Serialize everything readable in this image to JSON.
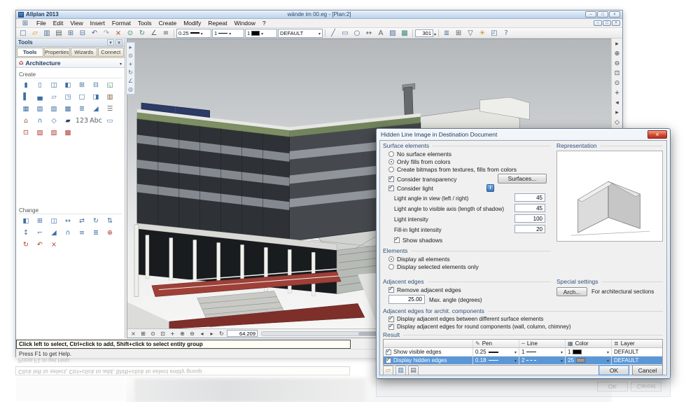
{
  "app": {
    "title": "Allplan 2013",
    "doc_title": "wände im 00.eg - [Plan:2]"
  },
  "window_controls": [
    {
      "name": "minimize-button",
      "glyph": "–"
    },
    {
      "name": "restore-button",
      "glyph": "□"
    },
    {
      "name": "close-button",
      "glyph": "×"
    }
  ],
  "menu": {
    "items": [
      "File",
      "Edit",
      "View",
      "Insert",
      "Format",
      "Tools",
      "Create",
      "Modify",
      "Repeat",
      "Window",
      "?"
    ]
  },
  "toolbar": {
    "left_icons": [
      {
        "name": "new-file-icon",
        "glyph": "□",
        "c": "#4a6e9e"
      },
      {
        "name": "open-file-icon",
        "glyph": "▱",
        "c": "#c9952c"
      },
      {
        "name": "save-icon",
        "glyph": "▥",
        "c": "#4a6e9e"
      },
      {
        "name": "print-icon",
        "glyph": "▤",
        "c": "#5a5f66"
      },
      {
        "name": "copy-icon",
        "glyph": "⊞",
        "c": "#4a6e9e"
      },
      {
        "name": "paste-icon",
        "glyph": "⊟",
        "c": "#4a6e9e"
      },
      {
        "name": "undo-icon",
        "glyph": "↶",
        "c": "#4a6e9e"
      },
      {
        "name": "redo-icon",
        "glyph": "↷",
        "c": "#9aa2ad"
      },
      {
        "name": "delete-icon",
        "glyph": "×",
        "c": "#b03a30"
      },
      {
        "name": "zoom-all-icon",
        "glyph": "⊙",
        "c": "#3e8a7a"
      },
      {
        "name": "refresh-icon",
        "glyph": "↻",
        "c": "#3e8a7a"
      },
      {
        "name": "measure-icon",
        "glyph": "∠",
        "c": "#5a5f66"
      },
      {
        "name": "options-icon",
        "glyph": "≡",
        "c": "#5a5f66"
      }
    ],
    "pen": {
      "value": "0.25"
    },
    "linetype": {
      "value": "1"
    },
    "linecolor": {
      "value": "1"
    },
    "layer": {
      "value": "DEFAULT"
    },
    "mid_icons": [
      {
        "name": "line-tool-icon",
        "glyph": "╱",
        "c": "#4a6e9e"
      },
      {
        "name": "rectangle-tool-icon",
        "glyph": "▭",
        "c": "#4a6e9e"
      },
      {
        "name": "circle-tool-icon",
        "glyph": "○",
        "c": "#4a6e9e"
      },
      {
        "name": "dimension-tool-icon",
        "glyph": "↔",
        "c": "#5a5f66"
      },
      {
        "name": "text-tool-icon",
        "glyph": "A",
        "c": "#5a5f66"
      },
      {
        "name": "hatch-tool-icon",
        "glyph": "▨",
        "c": "#4a6e9e"
      },
      {
        "name": "fill-tool-icon",
        "glyph": "▩",
        "c": "#3e8a7a"
      }
    ],
    "scale": {
      "value": "301"
    },
    "right_icons": [
      {
        "name": "layer-manager-icon",
        "glyph": "≣",
        "c": "#4a6e9e"
      },
      {
        "name": "group-icon",
        "glyph": "⊞",
        "c": "#5a5f66"
      },
      {
        "name": "filter-icon",
        "glyph": "▽",
        "c": "#5a5f66"
      },
      {
        "name": "light-icon",
        "glyph": "☀",
        "c": "#c9952c"
      },
      {
        "name": "views-icon",
        "glyph": "◰",
        "c": "#4a6e9e"
      },
      {
        "name": "help-icon",
        "glyph": "?",
        "c": "#4a6e9e"
      }
    ]
  },
  "palette": {
    "header": "Tools",
    "header_icons": [
      {
        "name": "pin-icon",
        "glyph": "▾"
      },
      {
        "name": "close-icon",
        "glyph": "×"
      }
    ],
    "tabs": [
      "Tools",
      "Properties",
      "Wizards",
      "Connect"
    ],
    "active_tab": "Tools",
    "category": "Architecture",
    "create_label": "Create",
    "change_label": "Change",
    "create_icons": [
      {
        "name": "wall-tool",
        "glyph": "▮",
        "c": "#3e6ea5"
      },
      {
        "name": "profile-wall-tool",
        "glyph": "▯",
        "c": "#3e6ea5"
      },
      {
        "name": "double-wall-tool",
        "glyph": "◫",
        "c": "#3e6ea5"
      },
      {
        "name": "door-tool",
        "glyph": "◧",
        "c": "#3e6ea5"
      },
      {
        "name": "window-tool",
        "glyph": "⊞",
        "c": "#3e6ea5"
      },
      {
        "name": "french-window-tool",
        "glyph": "⊟",
        "c": "#3e6ea5"
      },
      {
        "name": "smart-opening-tool",
        "glyph": "◱",
        "c": "#3e8a7a"
      },
      {
        "name": "column-tool",
        "glyph": "▌",
        "c": "#3e6ea5"
      },
      {
        "name": "beam-tool",
        "glyph": "▄",
        "c": "#3e6ea5"
      },
      {
        "name": "slab-tool",
        "glyph": "▱",
        "c": "#3e6ea5"
      },
      {
        "name": "recess-tool",
        "glyph": "◳",
        "c": "#3e6ea5"
      },
      {
        "name": "opening-tool",
        "glyph": "□",
        "c": "#3e6ea5"
      },
      {
        "name": "niche-tool",
        "glyph": "◨",
        "c": "#3e6ea5"
      },
      {
        "name": "chimney-tool",
        "glyph": "▥",
        "c": "#8a5a3a"
      },
      {
        "name": "grid-tool",
        "glyph": "▦",
        "c": "#3e6ea5"
      },
      {
        "name": "mesh-tool",
        "glyph": "▧",
        "c": "#3e6ea5"
      },
      {
        "name": "raster-tool",
        "glyph": "▨",
        "c": "#3e6ea5"
      },
      {
        "name": "ceiling-grid-tool",
        "glyph": "▩",
        "c": "#3e6ea5"
      },
      {
        "name": "stair-tool",
        "glyph": "≣",
        "c": "#3e6ea5"
      },
      {
        "name": "ramp-tool",
        "glyph": "◢",
        "c": "#3e6ea5"
      },
      {
        "name": "railing-tool",
        "glyph": "☰",
        "c": "#5a5f66"
      },
      {
        "name": "roof-tool",
        "glyph": "⌂",
        "c": "#8a5a3a"
      },
      {
        "name": "dormer-tool",
        "glyph": "∩",
        "c": "#3e6ea5"
      },
      {
        "name": "skylight-tool",
        "glyph": "◇",
        "c": "#3e6ea5"
      },
      {
        "name": "solar-panel-tool",
        "glyph": "▰",
        "c": "#2f3f6e"
      },
      {
        "name": "number-tool",
        "glyph": "123",
        "c": "#5a5f66"
      },
      {
        "name": "text-tool",
        "glyph": "Abc",
        "c": "#5a5f66"
      },
      {
        "name": "label-tool",
        "glyph": "▭",
        "c": "#3e6ea5"
      },
      {
        "name": "room-tool",
        "glyph": "⊡",
        "c": "#b03a30"
      },
      {
        "name": "surface-tool",
        "glyph": "▨",
        "c": "#b03a30"
      },
      {
        "name": "hatching-tool",
        "glyph": "▧",
        "c": "#b03a30"
      },
      {
        "name": "fill-tool",
        "glyph": "▩",
        "c": "#b03a30"
      }
    ],
    "change_icons": [
      {
        "name": "modify-wall-tool",
        "glyph": "◧",
        "c": "#3e6ea5"
      },
      {
        "name": "join-walls-tool",
        "glyph": "⊞",
        "c": "#3e6ea5"
      },
      {
        "name": "split-wall-tool",
        "glyph": "◫",
        "c": "#3e6ea5"
      },
      {
        "name": "stretch-tool",
        "glyph": "↔",
        "c": "#3e6ea5"
      },
      {
        "name": "mirror-tool",
        "glyph": "⇄",
        "c": "#3e6ea5"
      },
      {
        "name": "rotate-tool",
        "glyph": "↻",
        "c": "#3e6ea5"
      },
      {
        "name": "move-tool",
        "glyph": "⇅",
        "c": "#3e6ea5"
      },
      {
        "name": "modify-height-tool",
        "glyph": "↕",
        "c": "#3e6ea5"
      },
      {
        "name": "trim-tool",
        "glyph": "⌐",
        "c": "#3e6ea5"
      },
      {
        "name": "chamfer-tool",
        "glyph": "◢",
        "c": "#3e6ea5"
      },
      {
        "name": "fillet-tool",
        "glyph": "∩",
        "c": "#3e6ea5"
      },
      {
        "name": "offset-tool",
        "glyph": "≡",
        "c": "#3e6ea5"
      },
      {
        "name": "align-tool",
        "glyph": "≣",
        "c": "#3e6ea5"
      },
      {
        "name": "convert-tool",
        "glyph": "⊕",
        "c": "#b03a30"
      },
      {
        "name": "update-tool",
        "glyph": "↻",
        "c": "#b03a30"
      },
      {
        "name": "restore-tool",
        "glyph": "↶",
        "c": "#b03a30"
      },
      {
        "name": "delete-part-tool",
        "glyph": "×",
        "c": "#b03a30"
      }
    ],
    "strip_icons": [
      {
        "name": "select-icon",
        "glyph": "▸"
      },
      {
        "name": "zoom-icon",
        "glyph": "⊙"
      },
      {
        "name": "pan-icon",
        "glyph": "+"
      },
      {
        "name": "rotate-icon",
        "glyph": "↻"
      },
      {
        "name": "measure-icon",
        "glyph": "∠"
      },
      {
        "name": "camera-icon",
        "glyph": "◎"
      }
    ]
  },
  "viewport": {
    "coord": "64.209",
    "nav_icons": [
      {
        "name": "close-view-icon",
        "glyph": "×"
      },
      {
        "name": "grid-icon",
        "glyph": "⊞"
      },
      {
        "name": "zoom-fit-icon",
        "glyph": "⊙"
      },
      {
        "name": "zoom-section-icon",
        "glyph": "⊡"
      },
      {
        "name": "pan-icon",
        "glyph": "+"
      },
      {
        "name": "zoom-in-icon",
        "glyph": "⊕"
      },
      {
        "name": "zoom-out-icon",
        "glyph": "⊖"
      },
      {
        "name": "view-prev-icon",
        "glyph": "◂"
      },
      {
        "name": "view-next-icon",
        "glyph": "▸"
      },
      {
        "name": "redraw-icon",
        "glyph": "↻"
      }
    ]
  },
  "right_toolbar": {
    "icons": [
      {
        "name": "pointer-icon",
        "glyph": "▸",
        "c": "#3c4148"
      },
      {
        "name": "zoom-in-icon",
        "glyph": "⊕",
        "c": "#3c4148"
      },
      {
        "name": "zoom-out-icon",
        "glyph": "⊖",
        "c": "#3c4148"
      },
      {
        "name": "zoom-window-icon",
        "glyph": "⊡",
        "c": "#3c4148"
      },
      {
        "name": "zoom-all-icon",
        "glyph": "⊙",
        "c": "#3c4148"
      },
      {
        "name": "pan-icon",
        "glyph": "+",
        "c": "#3c4148"
      },
      {
        "name": "view-prev-icon",
        "glyph": "◂",
        "c": "#3c4148"
      },
      {
        "name": "view-next-icon",
        "glyph": "▸",
        "c": "#3c4148"
      },
      {
        "name": "view-3d-icon",
        "glyph": "◇",
        "c": "#3c4148"
      },
      {
        "name": "redline-pen-icon",
        "glyph": "✎",
        "c": "#c0392b"
      },
      {
        "name": "eraser-icon",
        "glyph": "▭",
        "c": "#3c4148"
      }
    ]
  },
  "statusbar": {
    "prompt": "Click left to select, Ctrl+click to add, Shift+click to select entity group",
    "help": "Press F1 to get Help.",
    "right_icons": [
      {
        "name": "grid-status-icon",
        "glyph": "⊞"
      },
      {
        "name": "model-status-icon",
        "glyph": "⌂"
      }
    ]
  },
  "dialog": {
    "title": "Hidden Line Image in Destination Document",
    "surface": {
      "label": "Surface elements",
      "radios": [
        "No surface elements",
        "Only fills from colors",
        "Create bitmaps from textures, fills from colors"
      ],
      "selected": "Only fills from colors",
      "transparency": "Consider transparency",
      "surfaces_btn": "Surfaces...",
      "light": "Consider light",
      "rows": [
        {
          "label": "Light angle in view (left / right)",
          "value": "45"
        },
        {
          "label": "Light angle to visible axis (length of shadow)",
          "value": "45"
        },
        {
          "label": "Light intensity",
          "value": "100"
        },
        {
          "label": "Fill-in light intensity",
          "value": "20"
        }
      ],
      "shadows": "Show shadows"
    },
    "representation_label": "Representation",
    "elements": {
      "label": "Elements",
      "radios": [
        "Display all elements",
        "Display selected elements only"
      ],
      "selected": "Display all elements"
    },
    "adjacent": {
      "label": "Adjacent edges",
      "remove": "Remove adjacent edges",
      "angle": "25.00",
      "angle_label": "Max. angle (degrees)"
    },
    "special": {
      "label": "Special settings",
      "btn": "Arch...",
      "note": "For architectural sections"
    },
    "archit": {
      "label": "Adjacent edges for archit. components",
      "checks": [
        "Display adjacent edges between different surface elements",
        "Display adjacent edges for round components (wall, column, chimney)"
      ]
    },
    "result": {
      "label": "Result",
      "columns": [
        "Pen",
        "Line",
        "Color",
        "Layer"
      ],
      "icons": [
        "✎",
        "─",
        "▦",
        "≣"
      ],
      "rows": [
        {
          "label": "Show visible edges",
          "pen": "0.25",
          "line": "1",
          "color": "1",
          "layer": "DEFAULT"
        },
        {
          "label": "Display hidden edges",
          "pen": "0.18",
          "line": "2",
          "color": "25",
          "layer": "DEFAULT"
        }
      ],
      "selected_row": "Display hidden edges"
    },
    "footer_icons": [
      {
        "name": "load-favorite-icon",
        "glyph": "▱",
        "c": "#c9952c"
      },
      {
        "name": "save-favorite-icon",
        "glyph": "▥",
        "c": "#3e6ea5"
      },
      {
        "name": "print-icon",
        "glyph": "▤",
        "c": "#5a5f66"
      }
    ],
    "ok": "OK",
    "cancel": "Cancel"
  },
  "colors": {
    "selection_blue": "#5b97d6",
    "close_red": "#cf4632",
    "accent": "#2a62b8"
  }
}
